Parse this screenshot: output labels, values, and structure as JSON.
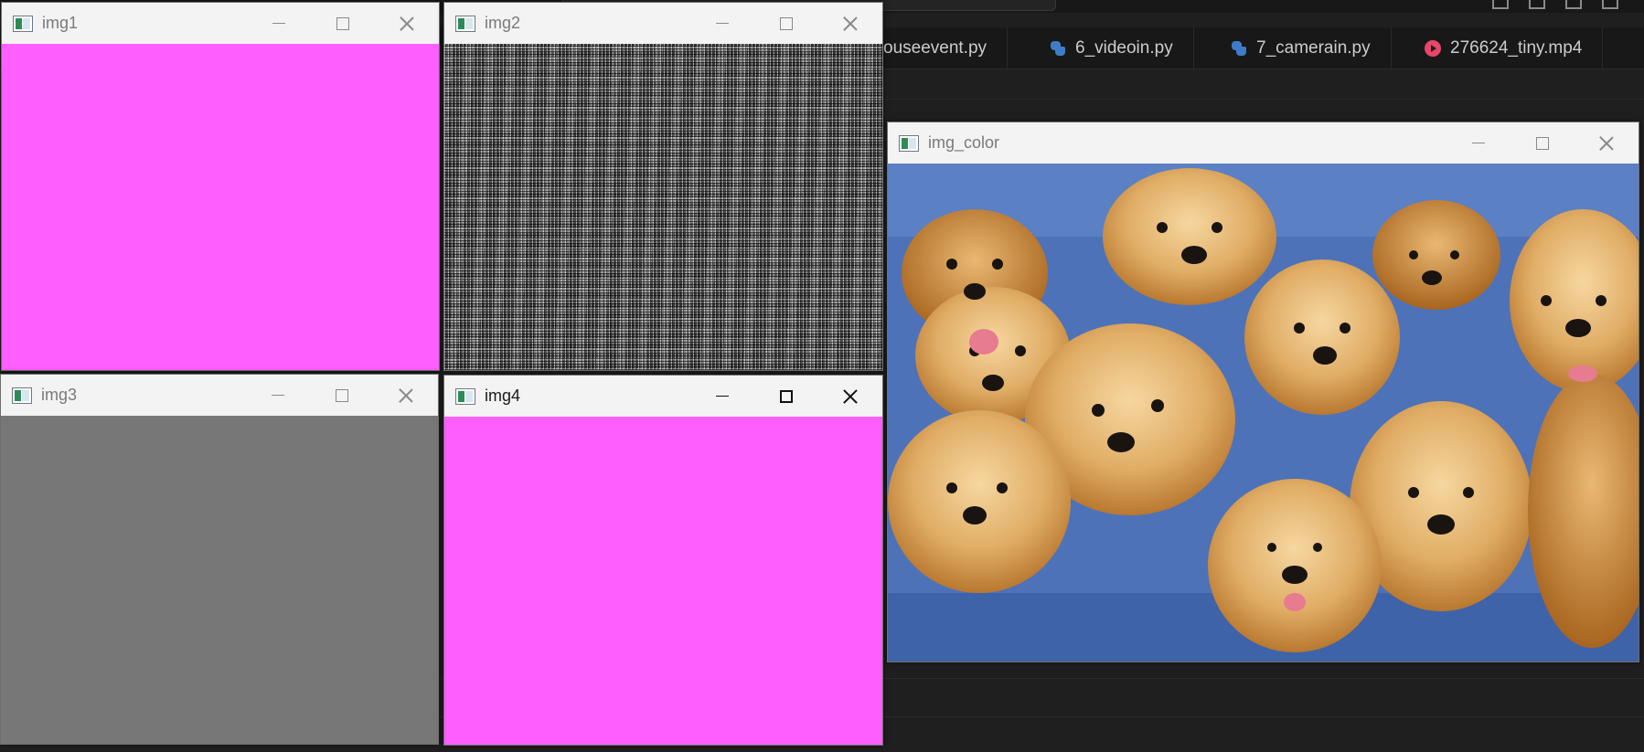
{
  "editor": {
    "tabs": [
      {
        "label": "ouseevent.py",
        "icon": "python-file-icon"
      },
      {
        "label": "6_videoin.py",
        "icon": "python-file-icon"
      },
      {
        "label": "7_camerain.py",
        "icon": "python-file-icon"
      },
      {
        "label": "276624_tiny.mp4",
        "icon": "video-file-icon"
      }
    ]
  },
  "windows": {
    "img1": {
      "title": "img1",
      "fill": "#ff5fff"
    },
    "img2": {
      "title": "img2"
    },
    "img3": {
      "title": "img3",
      "fill": "#777777"
    },
    "img4": {
      "title": "img4",
      "fill": "#ff5fff"
    },
    "img_color": {
      "title": "img_color"
    }
  },
  "colors": {
    "magenta": "#ff5fff",
    "gray": "#777777",
    "editor_bg": "#1f1f1f",
    "sofa_blue": "#4a6fb5"
  }
}
